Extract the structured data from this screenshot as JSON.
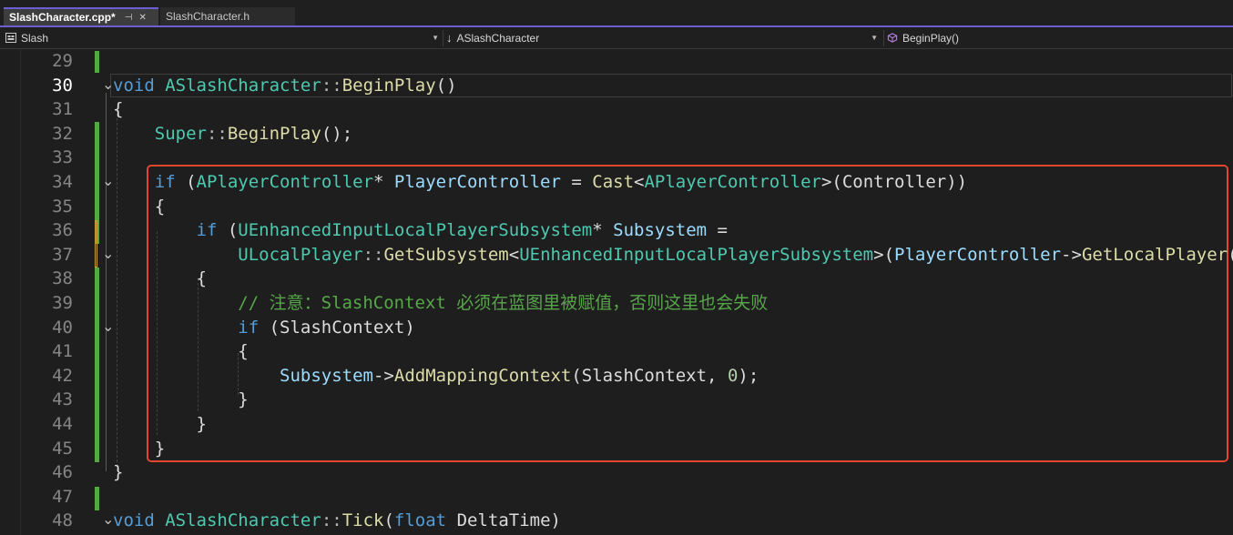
{
  "tabs": [
    {
      "label": "SlashCharacter.cpp*",
      "active": true
    },
    {
      "label": "SlashCharacter.h",
      "active": false
    }
  ],
  "nav": {
    "project": "Slash",
    "class": "ASlashCharacter",
    "member": "BeginPlay()"
  },
  "colors": {
    "keyword": "#569cd6",
    "type": "#4ec9b0",
    "function": "#dcdcaa",
    "variable": "#9cdcfe",
    "comment": "#57a64a",
    "highlight_border": "#e0472d",
    "accent": "#6d5fd3"
  },
  "editor": {
    "current_line": 30,
    "lines": [
      {
        "num": "29",
        "tokens": []
      },
      {
        "num": "30",
        "tokens": [
          {
            "t": "void",
            "c": "kw"
          },
          {
            "t": " "
          },
          {
            "t": "ASlashCharacter",
            "c": "ty"
          },
          {
            "t": "::",
            "c": "pu"
          },
          {
            "t": "BeginPlay",
            "c": "fn"
          },
          {
            "t": "()"
          }
        ]
      },
      {
        "num": "31",
        "tokens": [
          {
            "t": "{"
          }
        ]
      },
      {
        "num": "32",
        "tokens": [
          {
            "t": "    "
          },
          {
            "t": "Super",
            "c": "ty"
          },
          {
            "t": "::",
            "c": "pu"
          },
          {
            "t": "BeginPlay",
            "c": "fn"
          },
          {
            "t": "();"
          }
        ]
      },
      {
        "num": "33",
        "tokens": []
      },
      {
        "num": "34",
        "tokens": [
          {
            "t": "    "
          },
          {
            "t": "if",
            "c": "kw"
          },
          {
            "t": " ("
          },
          {
            "t": "APlayerController",
            "c": "ty"
          },
          {
            "t": "* "
          },
          {
            "t": "PlayerController",
            "c": "vr"
          },
          {
            "t": " = "
          },
          {
            "t": "Cast",
            "c": "fn"
          },
          {
            "t": "<"
          },
          {
            "t": "APlayerController",
            "c": "ty"
          },
          {
            "t": ">(Controller))"
          }
        ]
      },
      {
        "num": "35",
        "tokens": [
          {
            "t": "    {"
          }
        ]
      },
      {
        "num": "36",
        "tokens": [
          {
            "t": "        "
          },
          {
            "t": "if",
            "c": "kw"
          },
          {
            "t": " ("
          },
          {
            "t": "UEnhancedInputLocalPlayerSubsystem",
            "c": "ty"
          },
          {
            "t": "* "
          },
          {
            "t": "Subsystem",
            "c": "vr"
          },
          {
            "t": " ="
          }
        ]
      },
      {
        "num": "37",
        "tokens": [
          {
            "t": "            "
          },
          {
            "t": "ULocalPlayer",
            "c": "ty"
          },
          {
            "t": "::",
            "c": "pu"
          },
          {
            "t": "GetSubsystem",
            "c": "fn"
          },
          {
            "t": "<"
          },
          {
            "t": "UEnhancedInputLocalPlayerSubsystem",
            "c": "ty"
          },
          {
            "t": ">("
          },
          {
            "t": "PlayerController",
            "c": "vr"
          },
          {
            "t": "->"
          },
          {
            "t": "GetLocalPlayer",
            "c": "fn"
          },
          {
            "t": "()))"
          }
        ]
      },
      {
        "num": "38",
        "tokens": [
          {
            "t": "        {"
          }
        ]
      },
      {
        "num": "39",
        "tokens": [
          {
            "t": "            "
          },
          {
            "t": "// 注意：SlashContext 必须在蓝图里被赋值，否则这里也会失败",
            "c": "cm"
          }
        ]
      },
      {
        "num": "40",
        "tokens": [
          {
            "t": "            "
          },
          {
            "t": "if",
            "c": "kw"
          },
          {
            "t": " (SlashContext)"
          }
        ]
      },
      {
        "num": "41",
        "tokens": [
          {
            "t": "            {"
          }
        ]
      },
      {
        "num": "42",
        "tokens": [
          {
            "t": "                "
          },
          {
            "t": "Subsystem",
            "c": "vr"
          },
          {
            "t": "->"
          },
          {
            "t": "AddMappingContext",
            "c": "fn"
          },
          {
            "t": "(SlashContext, "
          },
          {
            "t": "0",
            "c": "nm"
          },
          {
            "t": ");"
          }
        ]
      },
      {
        "num": "43",
        "tokens": [
          {
            "t": "            }"
          }
        ]
      },
      {
        "num": "44",
        "tokens": [
          {
            "t": "        }"
          }
        ]
      },
      {
        "num": "45",
        "tokens": [
          {
            "t": "    }"
          }
        ]
      },
      {
        "num": "46",
        "tokens": [
          {
            "t": "}"
          }
        ]
      },
      {
        "num": "47",
        "tokens": []
      },
      {
        "num": "48",
        "tokens": [
          {
            "t": "void",
            "c": "kw"
          },
          {
            "t": " "
          },
          {
            "t": "ASlashCharacter",
            "c": "ty"
          },
          {
            "t": "::",
            "c": "pu"
          },
          {
            "t": "Tick",
            "c": "fn"
          },
          {
            "t": "("
          },
          {
            "t": "float",
            "c": "kw"
          },
          {
            "t": " DeltaTime)"
          }
        ]
      }
    ]
  }
}
